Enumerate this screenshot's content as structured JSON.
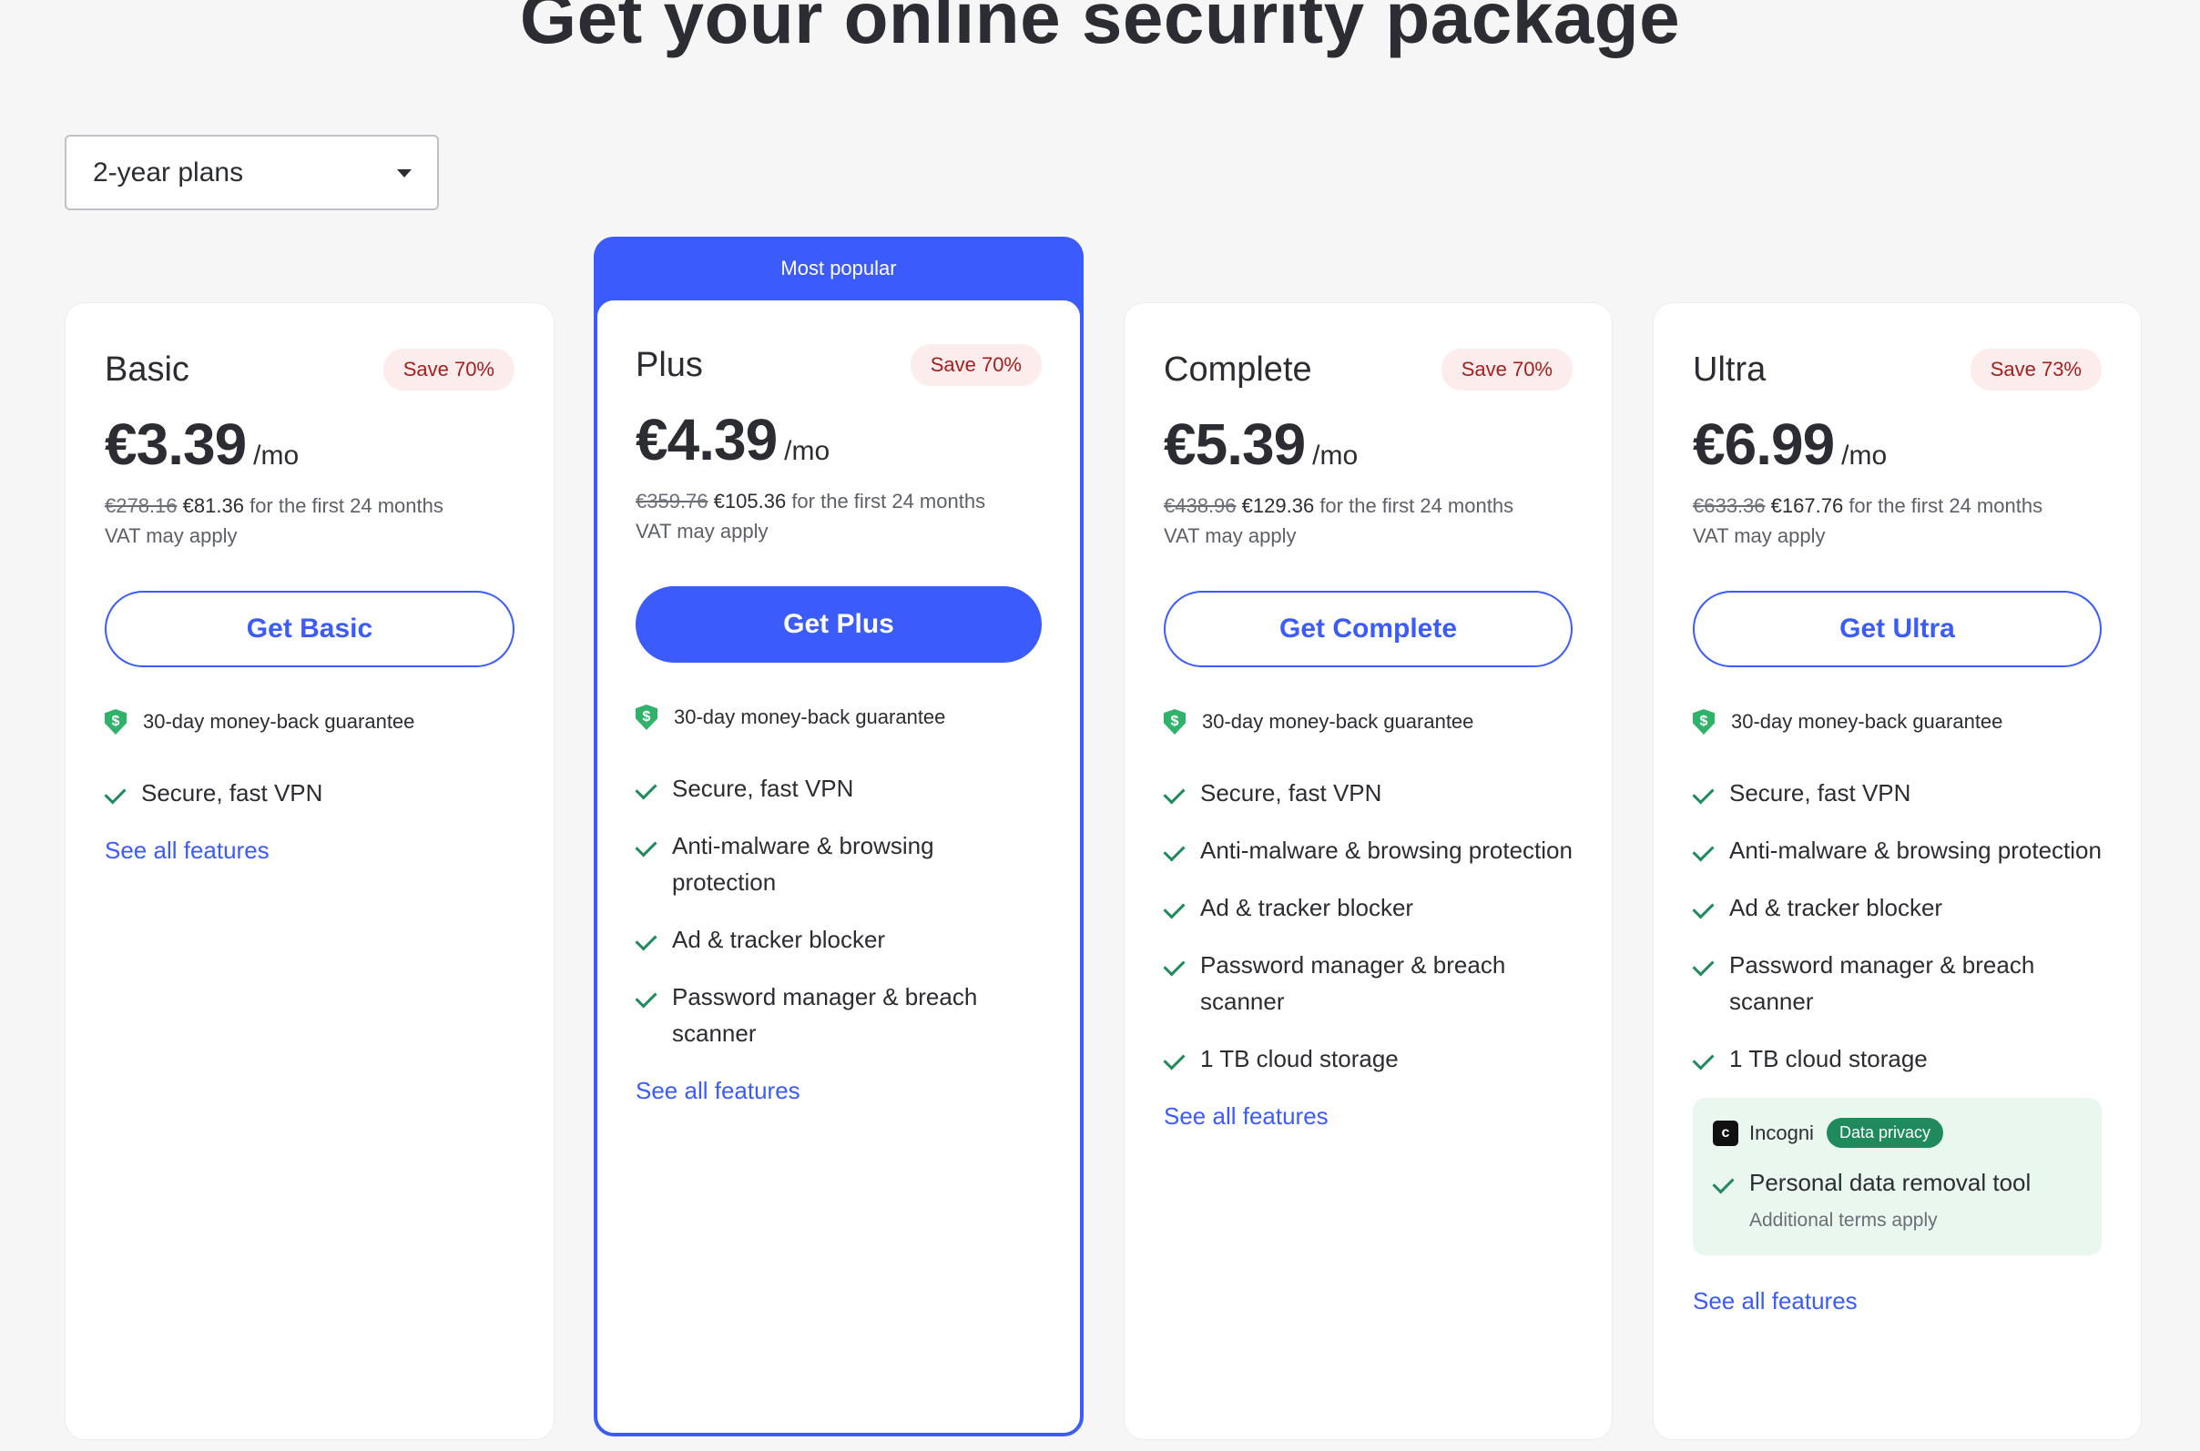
{
  "page": {
    "title": "Get your online security package"
  },
  "plan_select": {
    "value": "2-year plans"
  },
  "popular_label": "Most popular",
  "guarantee_text": "30-day money-back guarantee",
  "see_all": "See all features",
  "plans": [
    {
      "name": "Basic",
      "save": "Save 70%",
      "price": "€3.39",
      "per": "/mo",
      "old_total": "€278.16",
      "new_total": "€81.36",
      "period": "for the first 24 months",
      "vat": "VAT may apply",
      "cta": "Get Basic",
      "features": [
        "Secure, fast VPN"
      ]
    },
    {
      "name": "Plus",
      "save": "Save 70%",
      "price": "€4.39",
      "per": "/mo",
      "old_total": "€359.76",
      "new_total": "€105.36",
      "period": "for the first 24 months",
      "vat": "VAT may apply",
      "cta": "Get Plus",
      "features": [
        "Secure, fast VPN",
        "Anti-malware & browsing protection",
        "Ad & tracker blocker",
        "Password manager & breach scanner"
      ]
    },
    {
      "name": "Complete",
      "save": "Save 70%",
      "price": "€5.39",
      "per": "/mo",
      "old_total": "€438.96",
      "new_total": "€129.36",
      "period": "for the first 24 months",
      "vat": "VAT may apply",
      "cta": "Get Complete",
      "features": [
        "Secure, fast VPN",
        "Anti-malware & browsing protection",
        "Ad & tracker blocker",
        "Password manager & breach scanner",
        "1 TB cloud storage"
      ]
    },
    {
      "name": "Ultra",
      "save": "Save 73%",
      "price": "€6.99",
      "per": "/mo",
      "old_total": "€633.36",
      "new_total": "€167.76",
      "period": "for the first 24 months",
      "vat": "VAT may apply",
      "cta": "Get Ultra",
      "features": [
        "Secure, fast VPN",
        "Anti-malware & browsing protection",
        "Ad & tracker blocker",
        "Password manager & breach scanner",
        "1 TB cloud storage"
      ],
      "addon": {
        "brand": "Incogni",
        "badge": "Data privacy",
        "feature": "Personal data removal tool",
        "note": "Additional terms apply"
      }
    }
  ],
  "colors": {
    "accent": "#3b5bfb",
    "check": "#1f8a5b",
    "save_bg": "#fdecec",
    "save_text": "#a3201f",
    "addon_bg": "#e9f7ee"
  },
  "icons": {
    "guarantee": "shield-dollar-icon",
    "feature": "check-icon",
    "select": "caret-down-icon",
    "addon": "incogni-logo-icon"
  }
}
